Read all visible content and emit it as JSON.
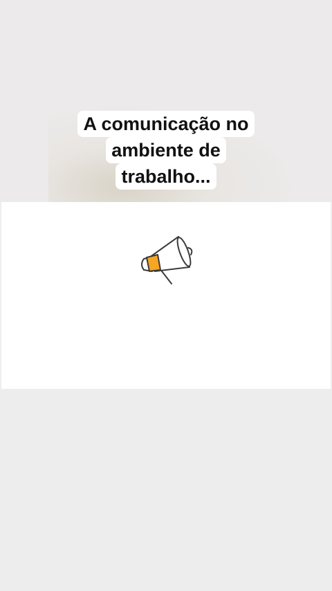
{
  "caption": {
    "lines": [
      "A comunicação no",
      "ambiente de",
      "trabalho..."
    ]
  },
  "icons": {
    "megaphone": "megaphone-icon"
  },
  "colors": {
    "accent": "#f5a623",
    "line": "#3a3a3a",
    "caption_bg": "#ffffff",
    "page_bg": "#eeeeef"
  }
}
